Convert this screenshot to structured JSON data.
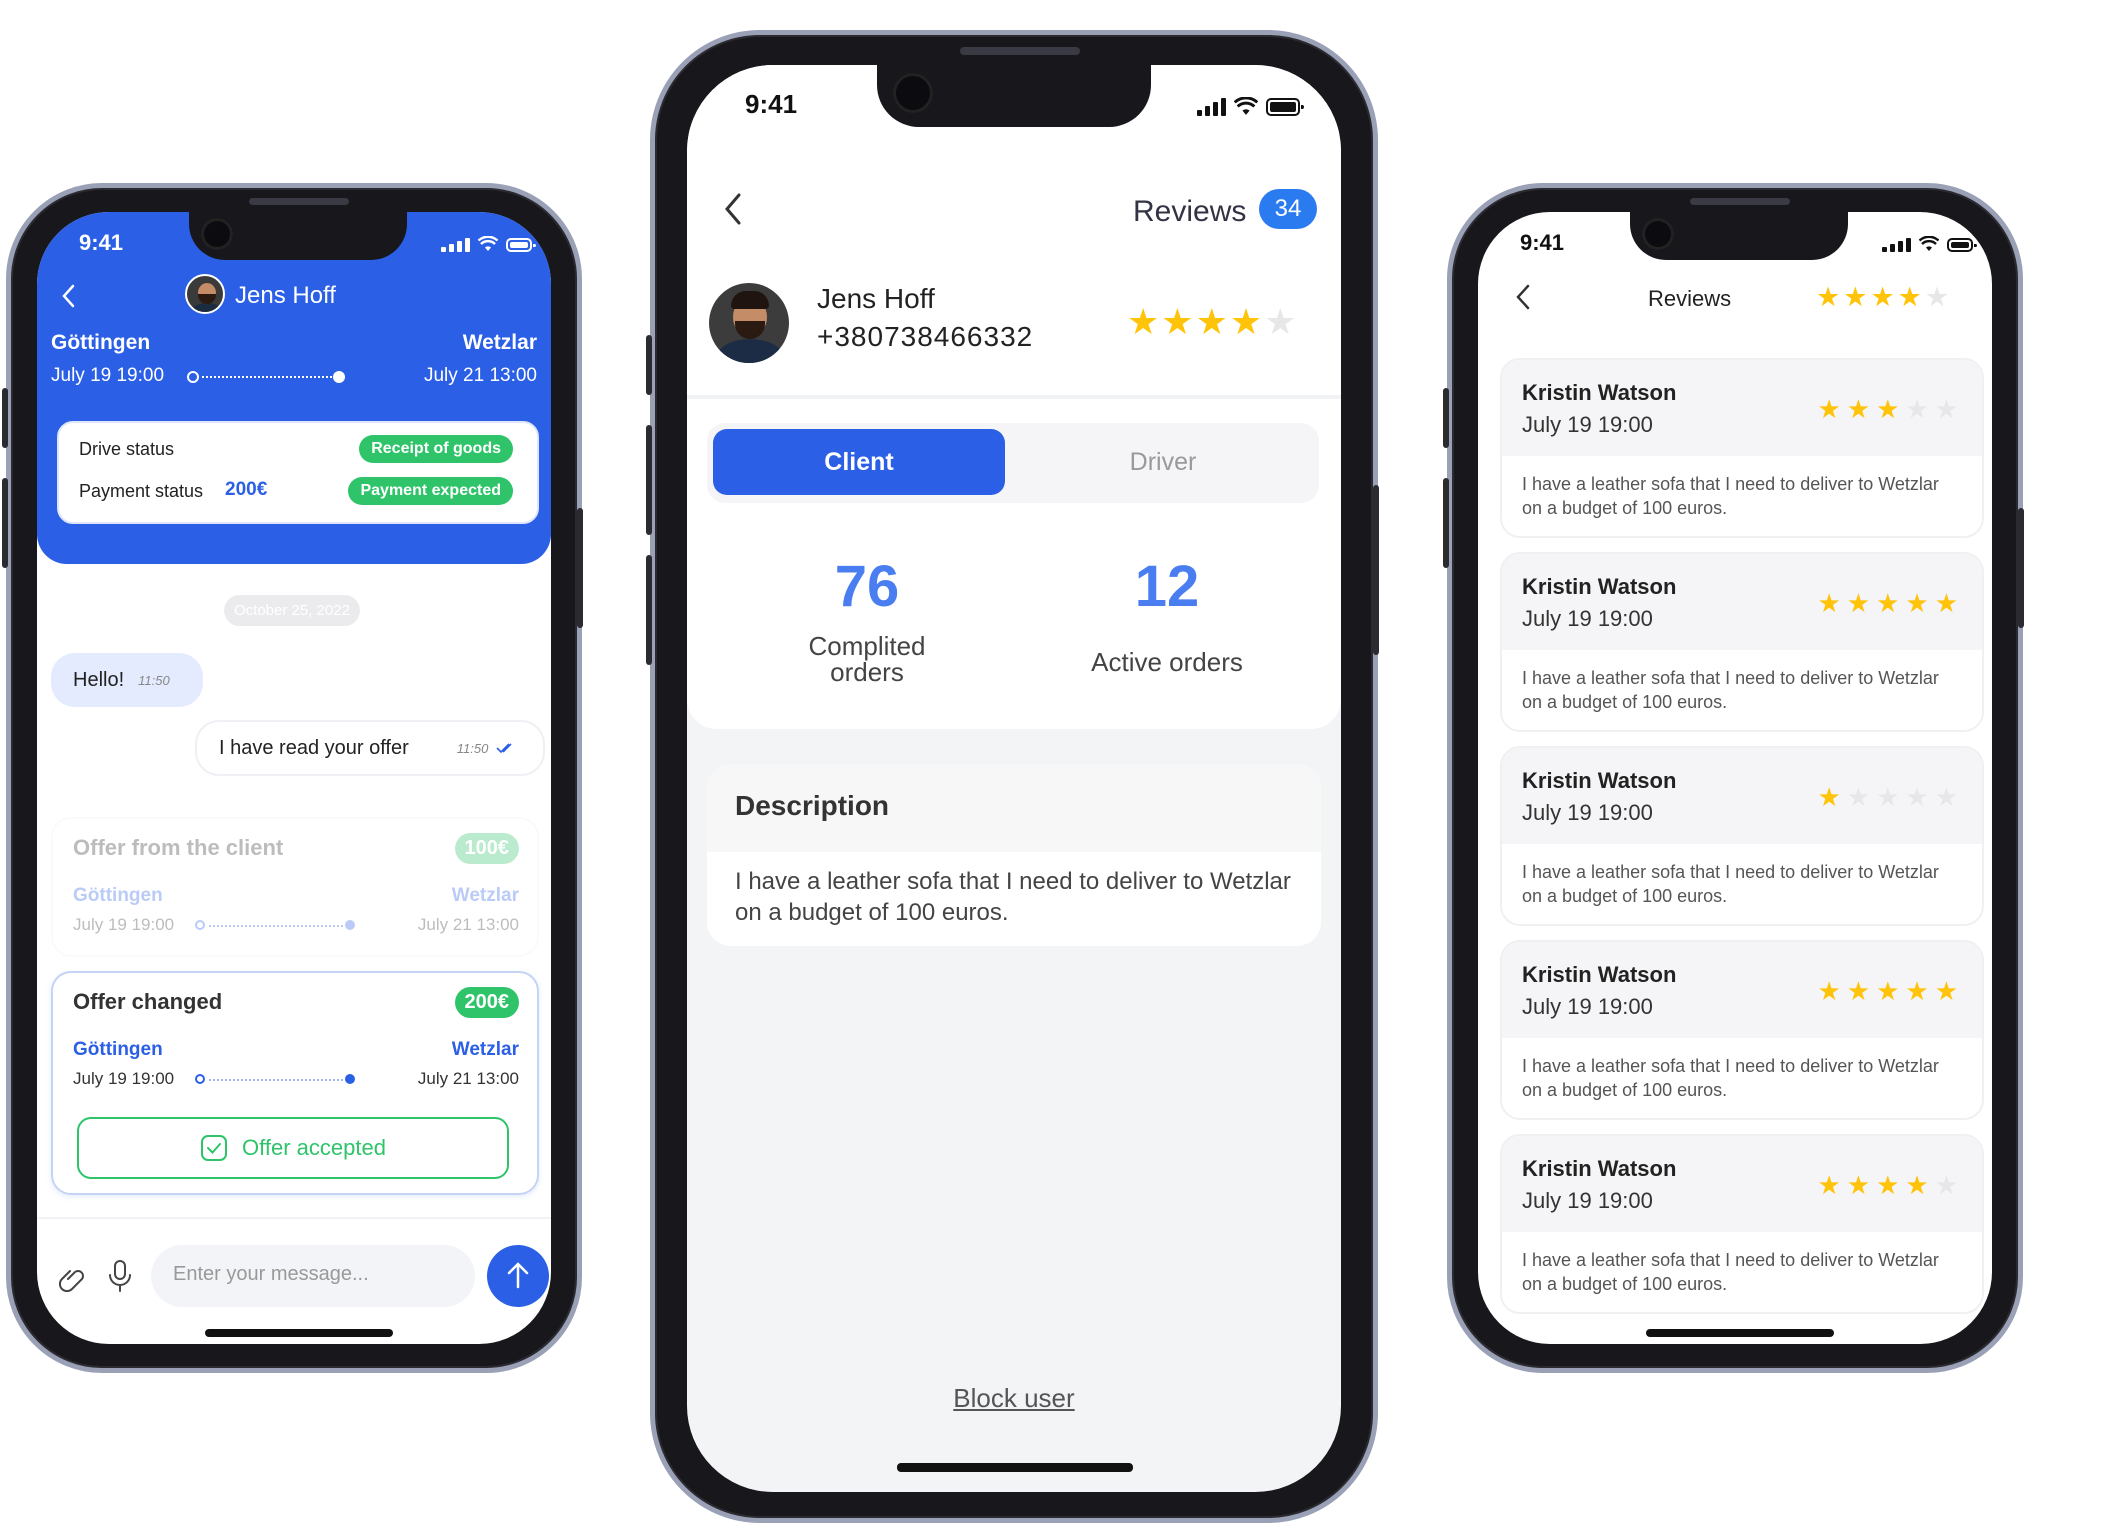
{
  "status_bar": {
    "time": "9:41"
  },
  "chat_screen": {
    "user_name": "Jens Hoff",
    "route": {
      "from": "Göttingen",
      "to": "Wetzlar",
      "from_date": "July 19 19:00",
      "to_date": "July 21 13:00"
    },
    "drive_status_label": "Drive status",
    "drive_status_value": "Receipt of goods",
    "payment_status_label": "Payment status",
    "payment_amount": "200€",
    "payment_status_value": "Payment expected",
    "date_chip": "October 25, 2022",
    "messages": [
      {
        "text": "Hello!",
        "time": "11:50"
      },
      {
        "text": "I have read your offer",
        "time": "11:50"
      }
    ],
    "old_offer": {
      "title": "Offer from the client",
      "price": "100€",
      "from": "Göttingen",
      "to": "Wetzlar",
      "from_date": "July 19 19:00",
      "to_date": "July 21 13:00"
    },
    "new_offer": {
      "title": "Offer changed",
      "price": "200€",
      "from": "Göttingen",
      "to": "Wetzlar",
      "from_date": "July 19 19:00",
      "to_date": "July 21 13:00",
      "accepted_label": "Offer accepted"
    },
    "input_placeholder": "Enter your message..."
  },
  "profile_screen": {
    "reviews_label": "Reviews",
    "reviews_count": "34",
    "name": "Jens Hoff",
    "phone": "+380738466332",
    "rating": 4,
    "tabs": [
      "Client",
      "Driver"
    ],
    "active_tab": "Client",
    "stats": [
      {
        "value": "76",
        "label_line1": "Complited",
        "label_line2": "orders"
      },
      {
        "value": "12",
        "label_line1": "Active orders",
        "label_line2": ""
      }
    ],
    "description_title": "Description",
    "description_text": "I have a leather sofa that I need to deliver to Wetzlar on a budget of 100 euros.",
    "block_label": "Block user"
  },
  "reviews_screen": {
    "title": "Reviews",
    "header_rating": 4,
    "reviews": [
      {
        "name": "Kristin Watson",
        "date": "July 19 19:00",
        "rating": 3,
        "text": "I have a leather sofa that I need to deliver to Wetzlar on a budget of 100 euros."
      },
      {
        "name": "Kristin Watson",
        "date": "July 19 19:00",
        "rating": 5,
        "text": "I have a leather sofa that I need to deliver to Wetzlar on a budget of 100 euros."
      },
      {
        "name": "Kristin Watson",
        "date": "July 19 19:00",
        "rating": 1,
        "text": "I have a leather sofa that I need to deliver to Wetzlar on a budget of 100 euros."
      },
      {
        "name": "Kristin Watson",
        "date": "July 19 19:00",
        "rating": 5,
        "text": "I have a leather sofa that I need to deliver to Wetzlar on a budget of 100 euros."
      },
      {
        "name": "Kristin Watson",
        "date": "July 19 19:00",
        "rating": 4,
        "text": "I have a leather sofa that I need to deliver to Wetzlar on a budget of 100 euros."
      }
    ]
  },
  "colors": {
    "primary": "#2a5fe6",
    "success": "#2fc46a",
    "star": "#ffc30a",
    "star_off": "#e7e7ea"
  },
  "icons": [
    "back-arrow-icon",
    "signal-icon",
    "wifi-icon",
    "battery-icon",
    "avatar",
    "double-check-icon",
    "check-icon",
    "attach-icon",
    "microphone-icon",
    "send-arrow-icon",
    "star-icon"
  ]
}
